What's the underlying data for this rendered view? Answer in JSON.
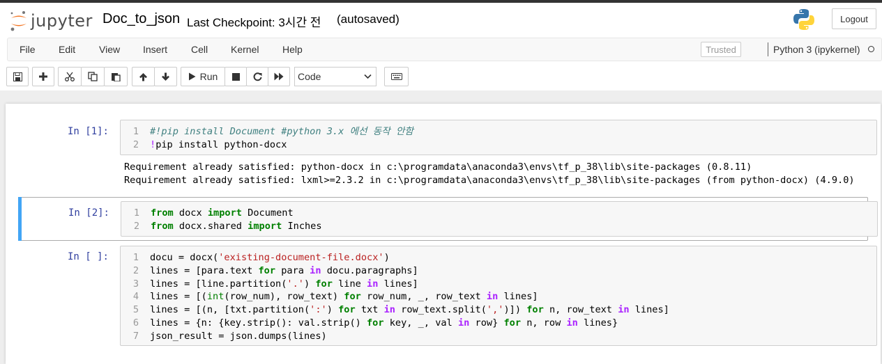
{
  "header": {
    "logo_text": "jupyter",
    "notebook_name": "Doc_to_json",
    "checkpoint": "Last Checkpoint: 3시간 전",
    "autosave": "(autosaved)",
    "logout_label": "Logout"
  },
  "menu": {
    "items": [
      "File",
      "Edit",
      "View",
      "Insert",
      "Cell",
      "Kernel",
      "Help"
    ],
    "trusted": "Trusted",
    "kernel_name": "Python 3 (ipykernel)"
  },
  "toolbar": {
    "run_label": "Run",
    "cell_type": "Code"
  },
  "cells": [
    {
      "prompt": "In [1]:",
      "lines": [
        "#!pip install Document #python 3.x 에선 동작 안함",
        "!pip install python-docx"
      ],
      "output": [
        "Requirement already satisfied: python-docx in c:\\programdata\\anaconda3\\envs\\tf_p_38\\lib\\site-packages (0.8.11)",
        "Requirement already satisfied: lxml>=2.3.2 in c:\\programdata\\anaconda3\\envs\\tf_p_38\\lib\\site-packages (from python-docx) (4.9.0)"
      ]
    },
    {
      "prompt": "In [2]:",
      "lines": [
        "from docx import Document",
        "from docx.shared import Inches"
      ]
    },
    {
      "prompt": "In [ ]:",
      "lines": [
        "docu = docx('existing-document-file.docx')",
        "lines = [para.text for para in docu.paragraphs]",
        "lines = [line.partition('.') for line in lines]",
        "lines = [(int(row_num), row_text) for row_num, _, row_text in lines]",
        "lines = [(n, [txt.partition(':') for txt in row_text.split(',')]) for n, row_text in lines]",
        "lines = {n: {key.strip(): val.strip() for key, _, val in row} for n, row in lines}",
        "json_result = json.dumps(lines)"
      ]
    }
  ],
  "colors": {
    "selected_bar": "#42a5f5",
    "prompt": "#303f9f",
    "keyword": "#008000",
    "string": "#ba2121",
    "comment": "#408080"
  }
}
